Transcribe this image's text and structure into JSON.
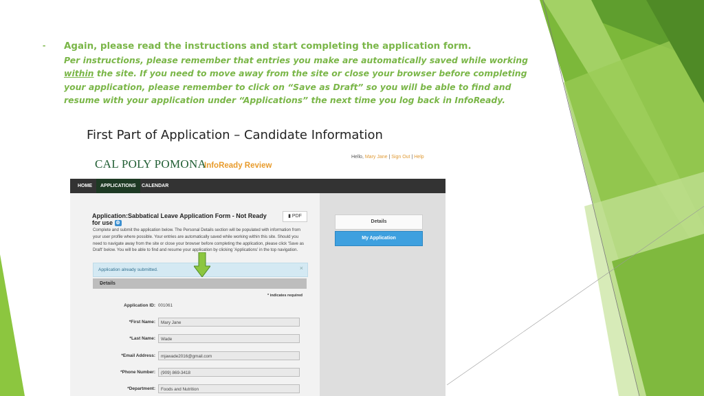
{
  "slide": {
    "bullet": "-",
    "instruction_heading": "Again, please read the instructions and start completing the application form.",
    "instruction_p1": "Per instructions, please remember that entries you make are automatically saved while working ",
    "instruction_within": "within",
    "instruction_p2": " the site.  If you need to move away from the site or close your browser before completing your application, please remember to click on “Save as Draft” so you will be able to find and resume with your application under “Applications” the next time you log back in InfoReady.",
    "subtitle": "First Part of Application – Candidate Information"
  },
  "header": {
    "hello": "Hello, ",
    "user": "Mary Jane",
    "sep": "|",
    "sign_out": "Sign Out",
    "help": "Help",
    "logo_text": "CAL POLY POMONA",
    "product": "InfoReady Review"
  },
  "nav": {
    "home": "HOME",
    "applications": "APPLICATIONS",
    "calendar": "CALENDAR"
  },
  "app": {
    "title": "Application:Sabbatical Leave Application Form - Not Ready for use",
    "pdf_label": "PDF",
    "description": "Complete and submit the application below. The Personal Details section will be populated with information from your user profile where possible. Your entries are automatically saved while working within this site. Should you need to navigate away from the site or close your browser before completing the application, please click 'Save as Draft' below. You will be able to find and resume your application by clicking 'Applications' in the top navigation.",
    "alert": "Application already submitted.",
    "alert_close": "×",
    "details_section": "Details",
    "required_note": "* indicates required",
    "buttons": {
      "details": "Details",
      "my_application": "My Application"
    }
  },
  "form": {
    "application_id_label": "Application ID:",
    "application_id": "001061",
    "first_name_label": "*First Name:",
    "first_name": "Mary Jane",
    "last_name_label": "*Last Name:",
    "last_name": "Wade",
    "email_label": "*Email Address:",
    "email": "mjawade2016@gmail.com",
    "phone_label": "*Phone Number:",
    "phone": "(909) 869-3418",
    "department_label": "*Department:",
    "department": "Foods and Nutrition"
  },
  "colors": {
    "accent_green": "#7ab648",
    "nav_bg": "#333333",
    "primary_blue": "#3ea0df"
  },
  "icons": {
    "arrow": "green-down-arrow-icon",
    "gear": "gear-icon",
    "pdf": "document-icon",
    "chevron": "chevron-down-icon",
    "close": "close-icon"
  }
}
